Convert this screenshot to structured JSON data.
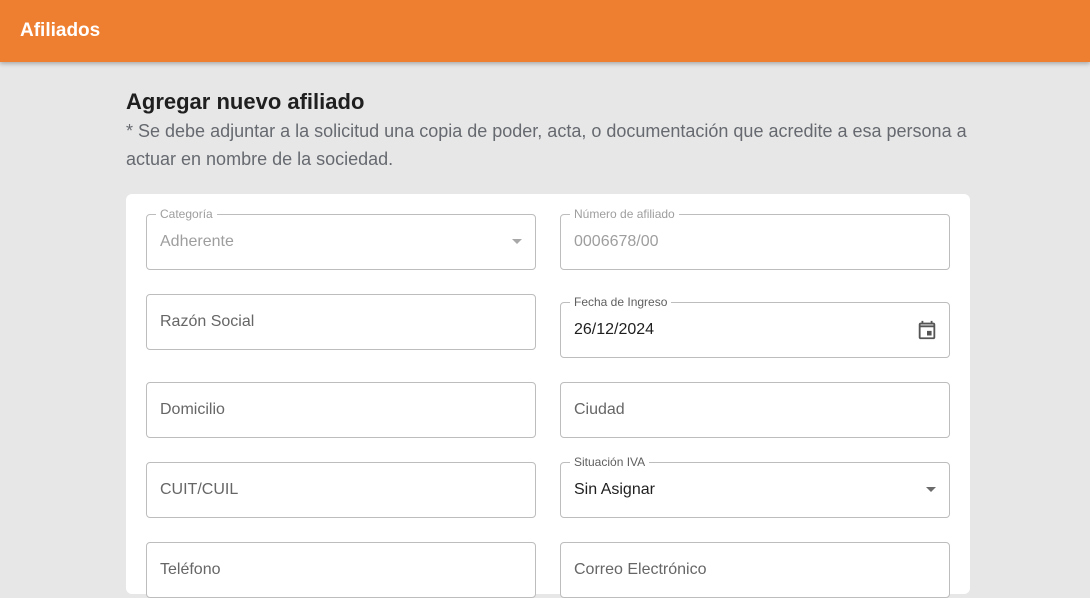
{
  "appbar": {
    "title": "Afiliados"
  },
  "form": {
    "title": "Agregar nuevo afiliado",
    "note": "* Se debe adjuntar a la solicitud una copia de poder, acta, o documentación que acredite a esa persona a actuar en nombre de la sociedad.",
    "fields": {
      "categoria": {
        "label": "Categoría",
        "value": "Adherente",
        "disabled": true,
        "icon": "chevron-down-icon"
      },
      "numero_afiliado": {
        "label": "Número de afiliado",
        "value": "0006678/00",
        "disabled": true
      },
      "razon_social": {
        "placeholder": "Razón Social"
      },
      "fecha_ingreso": {
        "label": "Fecha de Ingreso",
        "value": "26/12/2024",
        "icon": "calendar-icon"
      },
      "domicilio": {
        "placeholder": "Domicilio"
      },
      "ciudad": {
        "placeholder": "Ciudad"
      },
      "cuit": {
        "placeholder": "CUIT/CUIL"
      },
      "situacion_iva": {
        "label": "Situación IVA",
        "value": "Sin Asignar",
        "icon": "chevron-down-icon"
      },
      "telefono": {
        "placeholder": "Teléfono"
      },
      "correo": {
        "placeholder": "Correo Electrónico"
      }
    }
  },
  "colors": {
    "accent": "#ef7f30",
    "background": "#e7e7e7",
    "card": "#ffffff"
  }
}
